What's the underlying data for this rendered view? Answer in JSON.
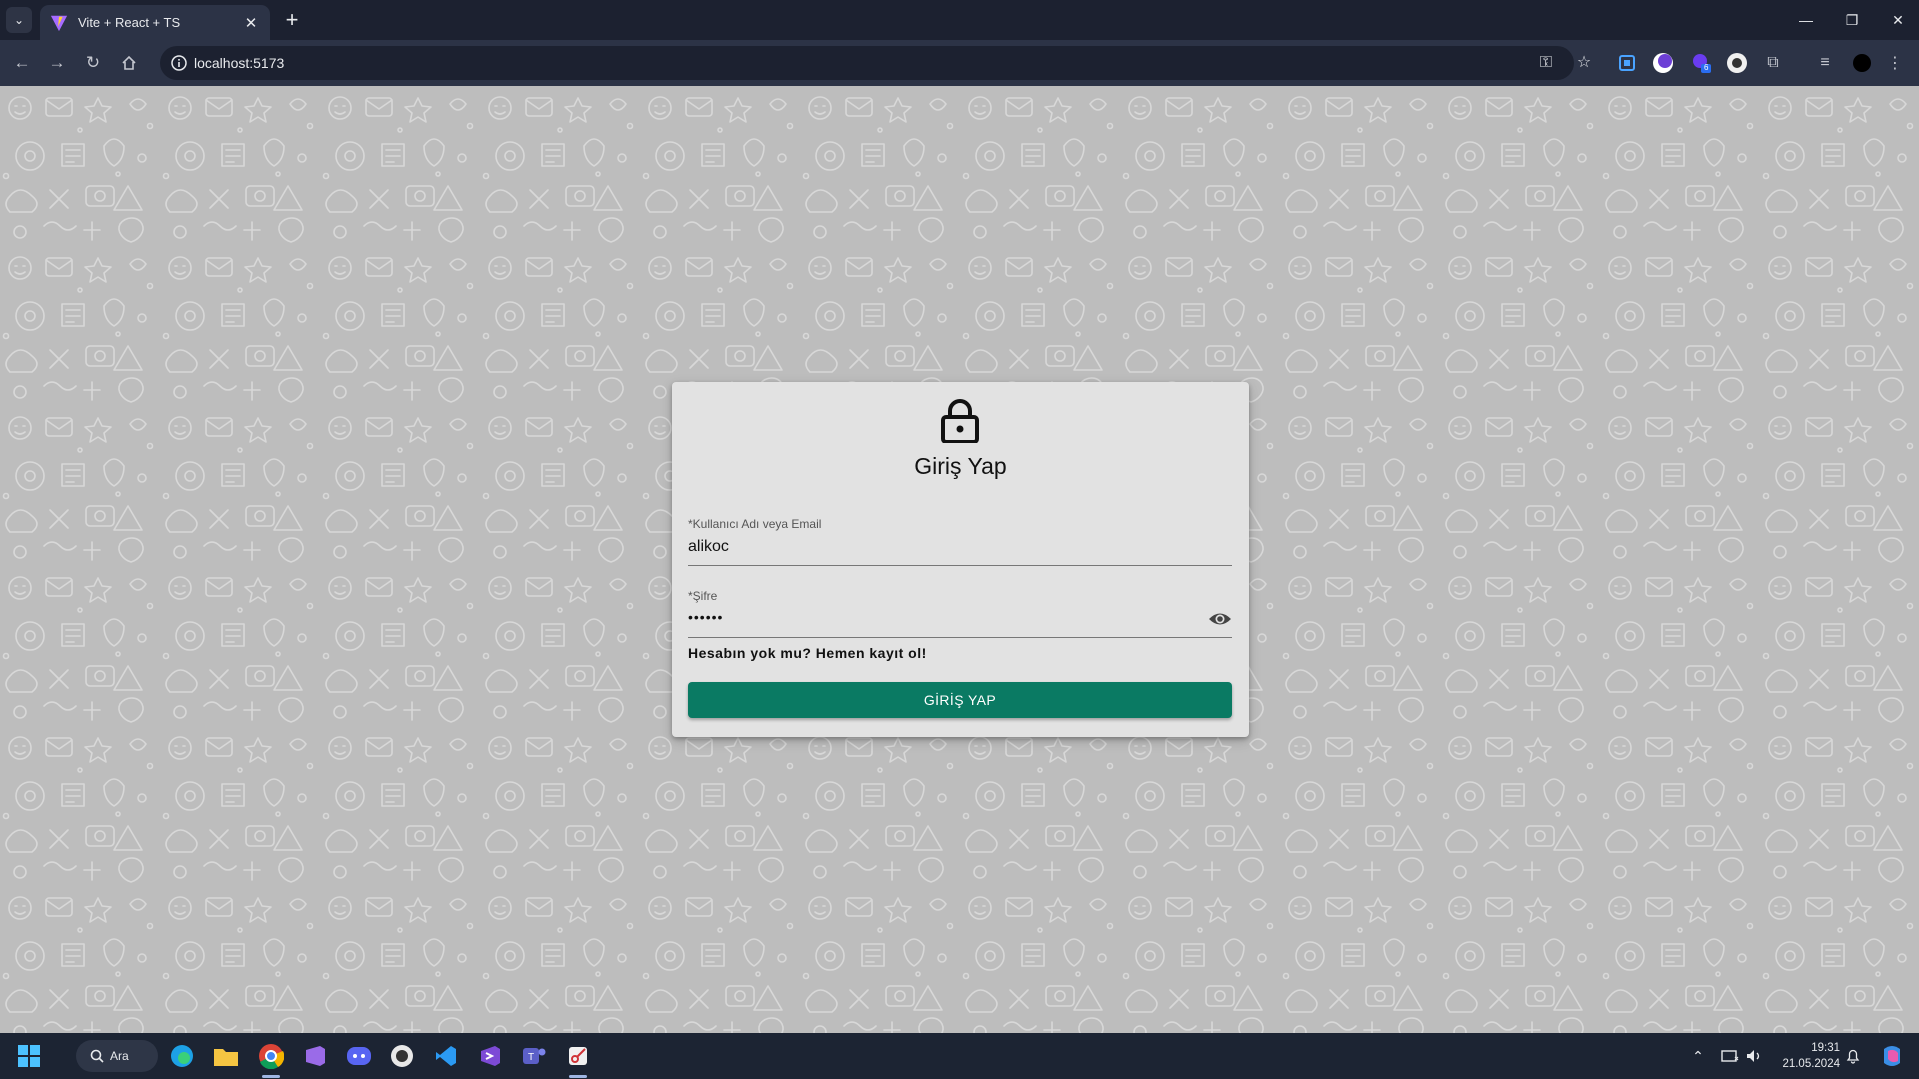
{
  "browser": {
    "tab_title": "Vite + React + TS",
    "url": "localhost:5173",
    "extensions_badge": "6"
  },
  "login": {
    "title": "Giriş Yap",
    "username_label": "*Kullanıcı Adı veya Email",
    "username_value": "alikoc",
    "password_label": "*Şifre",
    "password_value": "••••••",
    "signup_text": "Hesabın yok mu? Hemen kayıt ol!",
    "submit_label": "GİRİŞ YAP"
  },
  "taskbar": {
    "search_label": "Ara",
    "time": "19:31",
    "date": "21.05.2024"
  },
  "colors": {
    "accent": "#0a7a63",
    "page_background": "#bdbdbd",
    "card_background": "#e2e2e2"
  }
}
